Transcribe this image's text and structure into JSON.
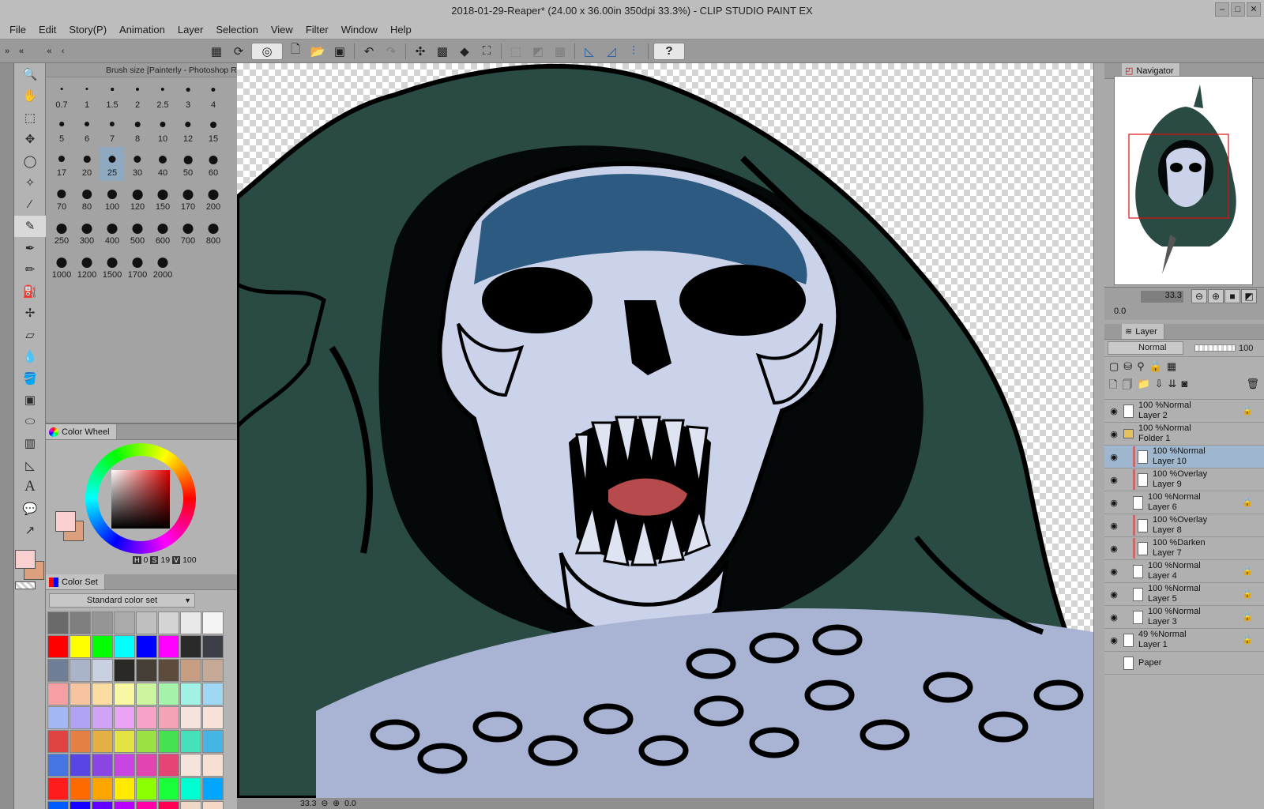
{
  "window": {
    "title": "2018-01-29-Reaper* (24.00 x 36.00in 350dpi 33.3%) - CLIP STUDIO PAINT EX"
  },
  "menu": [
    "File",
    "Edit",
    "Story(P)",
    "Animation",
    "Layer",
    "Selection",
    "View",
    "Filter",
    "Window",
    "Help"
  ],
  "brush_panel": {
    "title": "Brush size [Painterly - Photoshop R",
    "sizes": [
      "0.7",
      "1",
      "1.5",
      "2",
      "2.5",
      "3",
      "4",
      "5",
      "6",
      "7",
      "8",
      "10",
      "12",
      "15",
      "17",
      "20",
      "25",
      "30",
      "40",
      "50",
      "60",
      "70",
      "80",
      "100",
      "120",
      "150",
      "170",
      "200",
      "250",
      "300",
      "400",
      "500",
      "600",
      "700",
      "800",
      "1000",
      "1200",
      "1500",
      "1700",
      "2000"
    ],
    "selected": "25"
  },
  "color_wheel": {
    "tab": "Color Wheel",
    "h_label": "H",
    "s_label": "S",
    "v_label": "V",
    "h": "0",
    "s": "19",
    "v": "100",
    "main_color": "#f9cfcf",
    "sub_color": "#dba07e"
  },
  "color_set": {
    "tab": "Color Set",
    "set_name": "Standard color set",
    "colors": [
      "#6a6a6a",
      "#7f7f7f",
      "#959595",
      "#aaaaaa",
      "#bfbfbf",
      "#d4d4d4",
      "#e9e9e9",
      "#f4f4f4",
      "#ff0000",
      "#ffff00",
      "#00ff00",
      "#00ffff",
      "#0000ff",
      "#ff00ff",
      "#2a2a2a",
      "#3c3f46",
      "#6e7e96",
      "#a9b4cb",
      "#c8d0e2",
      "#2b2926",
      "#463f35",
      "#5d4b3b",
      "#c89e83",
      "#c6a896",
      "#f4a0a2",
      "#f7c4a2",
      "#fbdca3",
      "#f9f8a2",
      "#cdf5a0",
      "#a4f3a8",
      "#9ff2e4",
      "#a0d8f4",
      "#a3b6f5",
      "#b0a3f5",
      "#cfa3f5",
      "#eba3f5",
      "#f5a3c6",
      "#f3a3b5",
      "#f7e3dd",
      "#f8e1d8",
      "#e14343",
      "#e58045",
      "#e4b044",
      "#e3e343",
      "#9be144",
      "#45e151",
      "#45e1b8",
      "#45b5e3",
      "#4574e3",
      "#5845e3",
      "#8a45e3",
      "#c845e3",
      "#e345b0",
      "#e34574",
      "#f5e4dc",
      "#f7dfd1",
      "#ff1c1c",
      "#ff6a00",
      "#ffa500",
      "#ffea00",
      "#8cff00",
      "#1aff3b",
      "#00ffd0",
      "#00a6ff",
      "#005cff",
      "#1300ff",
      "#6100ff",
      "#b800ff",
      "#ff00a8",
      "#ff0055",
      "#f0d8c6",
      "#f5d7c5"
    ]
  },
  "canvas": {
    "zoom": "33.3",
    "rotation": "0.0"
  },
  "navigator": {
    "tab": "Navigator",
    "zoom": "33.3",
    "rotation": "0.0"
  },
  "layer_panel": {
    "tab": "Layer",
    "blend_mode": "Normal",
    "opacity": "100",
    "layers": [
      {
        "name": "Layer 2",
        "prop": "100 %Normal",
        "indent": 0,
        "selected": false,
        "lock": true,
        "folder": false,
        "clip": false
      },
      {
        "name": "Folder 1",
        "prop": "100 %Normal",
        "indent": 0,
        "selected": false,
        "lock": false,
        "folder": true,
        "clip": false
      },
      {
        "name": "Layer 10",
        "prop": "100 %Normal",
        "indent": 1,
        "selected": true,
        "lock": false,
        "folder": false,
        "clip": true
      },
      {
        "name": "Layer 9",
        "prop": "100 %Overlay",
        "indent": 1,
        "selected": false,
        "lock": false,
        "folder": false,
        "clip": true
      },
      {
        "name": "Layer 6",
        "prop": "100 %Normal",
        "indent": 1,
        "selected": false,
        "lock": true,
        "folder": false,
        "clip": false
      },
      {
        "name": "Layer 8",
        "prop": "100 %Overlay",
        "indent": 1,
        "selected": false,
        "lock": false,
        "folder": false,
        "clip": true
      },
      {
        "name": "Layer 7",
        "prop": "100 %Darken",
        "indent": 1,
        "selected": false,
        "lock": false,
        "folder": false,
        "clip": true
      },
      {
        "name": "Layer 4",
        "prop": "100 %Normal",
        "indent": 1,
        "selected": false,
        "lock": true,
        "folder": false,
        "clip": false
      },
      {
        "name": "Layer 5",
        "prop": "100 %Normal",
        "indent": 1,
        "selected": false,
        "lock": true,
        "folder": false,
        "clip": false
      },
      {
        "name": "Layer 3",
        "prop": "100 %Normal",
        "indent": 1,
        "selected": false,
        "lock": true,
        "folder": false,
        "clip": false
      },
      {
        "name": "Layer 1",
        "prop": "49 %Normal",
        "indent": 0,
        "selected": false,
        "lock": true,
        "folder": false,
        "clip": false
      },
      {
        "name": "Paper",
        "prop": "",
        "indent": 0,
        "selected": false,
        "lock": false,
        "folder": false,
        "clip": false
      }
    ]
  },
  "colors": {
    "ui_panel": "#b3b3b3",
    "selection": "#9fb7ce",
    "hood": "#2a4a44",
    "skull": "#cbd3ea",
    "skull_shadow": "#2d5a80"
  }
}
